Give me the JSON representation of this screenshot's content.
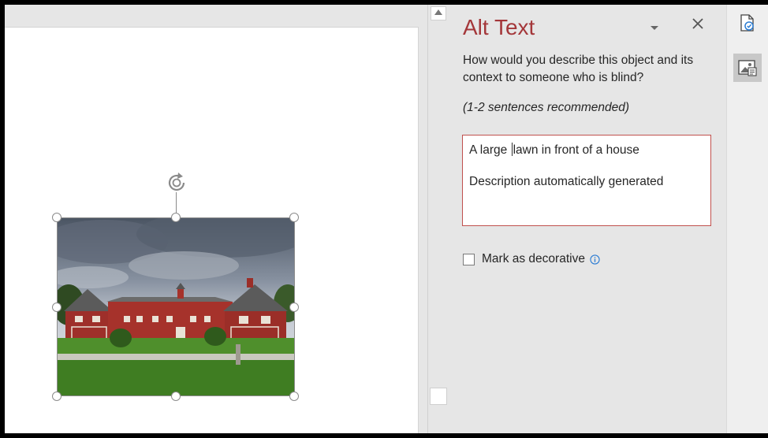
{
  "pane": {
    "title": "Alt Text",
    "question": "How would you describe this object and its context to someone who is blind?",
    "hint": "(1-2 sentences recommended)",
    "alt_text_line1_before_cursor": "A large ",
    "alt_text_line1_after_cursor": "lawn in front of a house",
    "alt_text_line2": "Description automatically generated",
    "decorative_label": "Mark as decorative",
    "decorative_checked": false
  },
  "icons": {
    "dropdown": "chevron-down-icon",
    "close": "close-icon",
    "info": "info-icon",
    "side_top": "accessibility-check-icon",
    "side_active": "alt-text-icon",
    "rotate": "rotate-icon"
  },
  "colors": {
    "title": "#a4373a",
    "box_border": "#c0504d",
    "info": "#2b7cd3"
  },
  "image": {
    "subject": "red barn building with green lawn"
  }
}
